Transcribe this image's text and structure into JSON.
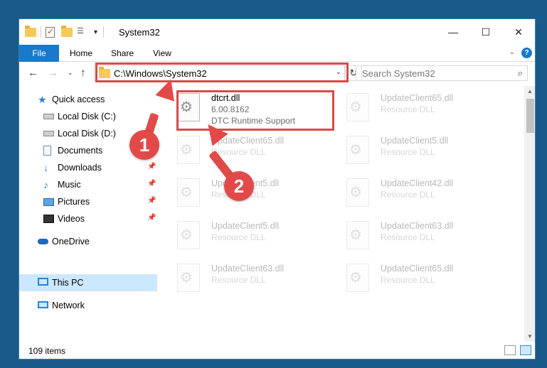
{
  "window": {
    "title": "System32",
    "controls": {
      "minimize": "—",
      "maximize": "☐",
      "close": "✕"
    }
  },
  "ribbon": {
    "tabs": [
      {
        "label": "File"
      },
      {
        "label": "Home"
      },
      {
        "label": "Share"
      },
      {
        "label": "View"
      }
    ],
    "help": "?"
  },
  "nav": {
    "address_path": "C:\\Windows\\System32",
    "search_placeholder": "Search System32"
  },
  "sidebar": {
    "items": [
      {
        "label": "Quick access",
        "icon": "star-icon"
      },
      {
        "label": "Local Disk (C:)",
        "icon": "drive-icon"
      },
      {
        "label": "Local Disk (D:)",
        "icon": "drive-icon"
      },
      {
        "label": "Documents",
        "icon": "document-icon",
        "pinned": true
      },
      {
        "label": "Downloads",
        "icon": "download-icon",
        "pinned": true
      },
      {
        "label": "Music",
        "icon": "music-icon",
        "pinned": true
      },
      {
        "label": "Pictures",
        "icon": "picture-icon",
        "pinned": true
      },
      {
        "label": "Videos",
        "icon": "video-icon",
        "pinned": true
      },
      {
        "label": "OneDrive",
        "icon": "cloud-icon"
      },
      {
        "label": "This PC",
        "icon": "computer-icon",
        "selected": true
      },
      {
        "label": "Network",
        "icon": "network-icon"
      }
    ]
  },
  "files": [
    {
      "name": "dtcrt.dll",
      "version": "6.00.8162",
      "description": "DTC Runtime Support",
      "highlighted": true
    },
    {
      "name": "UpdateClient65.dll",
      "version": "Resource DLL"
    },
    {
      "name": "UpdateClient65.dll",
      "version": "Resource DLL"
    },
    {
      "name": "UpdateClient5.dll",
      "version": "Resource DLL"
    },
    {
      "name": "UpdateClient5.dll",
      "version": "Resource DLL"
    },
    {
      "name": "UpdateClient42.dll",
      "version": "Resource DLL"
    },
    {
      "name": "UpdateClient5.dll",
      "version": "Resource DLL"
    },
    {
      "name": "UpdateClient63.dll",
      "version": "Resource DLL"
    },
    {
      "name": "UpdateClient63.dll",
      "version": "Resource DLL"
    },
    {
      "name": "UpdateClient65.dll",
      "version": "Resource DLL"
    }
  ],
  "status": {
    "item_count": "109 items"
  },
  "callouts": [
    {
      "number": "1"
    },
    {
      "number": "2"
    }
  ],
  "colors": {
    "accent": "#1979ca",
    "highlight": "#d84a4a",
    "selected_bg": "#cce8ff"
  }
}
